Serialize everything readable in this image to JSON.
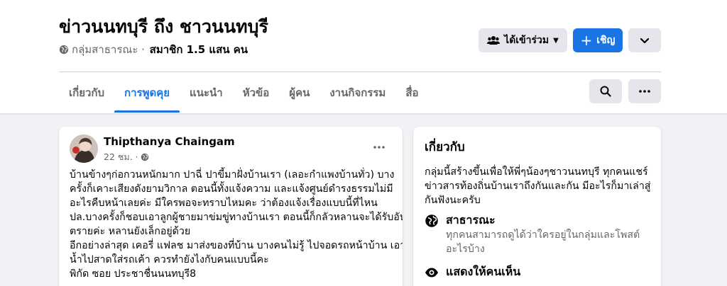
{
  "group": {
    "title": "ข่าวนนทบุรี ถึง ชาวนนทบุรี",
    "privacy": "กลุ่มสาธารณะ ·",
    "members": "สมาชิก 1.5 แสน คน"
  },
  "actions": {
    "joined_label": "ได้เข้าร่วม",
    "invite_label": "เชิญ"
  },
  "tabs": [
    {
      "label": "เกี่ยวกับ",
      "active": false
    },
    {
      "label": "การพูดคุย",
      "active": true
    },
    {
      "label": "แนะนำ",
      "active": false
    },
    {
      "label": "หัวข้อ",
      "active": false
    },
    {
      "label": "ผู้คน",
      "active": false
    },
    {
      "label": "งานกิจกรรม",
      "active": false
    },
    {
      "label": "สื่อ",
      "active": false
    }
  ],
  "post": {
    "author": "Thipthanya Chaingam",
    "time": "22 ชม. ·",
    "body_lines": [
      "บ้านข้างๆก่อกวนหนักมาก ปาฉี่ ปาขี้มาฝั่งบ้านเรา (เลอะกำแพงบ้านทั่ว) บาง",
      "ครั้งก็เคาะเสียงดังยามวิกาล ตอนนี้ทั้งแจ้งความ และแจ้งศูนย์ดำรงธรรมไม่มี",
      "อะไรคืบหน้าเลยค่ะ มีใครพอจะทราบไหมคะ ว่าต้องแจ้งเรื่องแบบนี้ที่ไหน",
      "ปล.บางครั้งก็ชอบเอาลูกผู้ชายมาข่มขู่ทางบ้านเรา ตอนนี้ก็กลัวหลานจะได้รับอัน",
      "ตรายค่ะ หลานยังเล็กอยู่ด้วย",
      "อีกอย่างล่าสุด เคอรี่ แฟลช มาส่งของที่บ้าน บางคนไม่รู้ ไปจอดรถหน้าบ้าน เอา",
      "น้ำไปสาดใส่รถเค้า ควรทำยังไงกับคนแบบนี้คะ",
      "พิกัด ซอย ประชาชื่นนนทบุรี8"
    ]
  },
  "about": {
    "title": "เกี่ยวกับ",
    "desc_lines": [
      "กลุ่มนี้สร้างขึ้นเพื่อให้พี่ๆน้องๆชาวนนทบุรี ทุกคนแชร์",
      "ข่าวสารท้องถิ่นบ้านเราถึงกันและกัน มีอะไรก็มาเล่าสู่",
      "กันฟังนะครับ"
    ],
    "public_title": "สาธารณะ",
    "public_desc_lines": [
      "ทุกคนสามารถดูได้ว่าใครอยู่ในกลุ่มและโพสต์",
      "อะไรบ้าง"
    ],
    "visible_title": "แสดงให้คนเห็น"
  },
  "colors": {
    "accent": "#1b74e4",
    "secondary_text": "#65676b",
    "button_gray": "#e4e6eb",
    "background": "#f0f2f5"
  },
  "icons": [
    "globe-icon",
    "people-icon",
    "caret-down-icon",
    "plus-icon",
    "chevron-down-icon",
    "search-icon",
    "more-icon",
    "eye-icon"
  ]
}
